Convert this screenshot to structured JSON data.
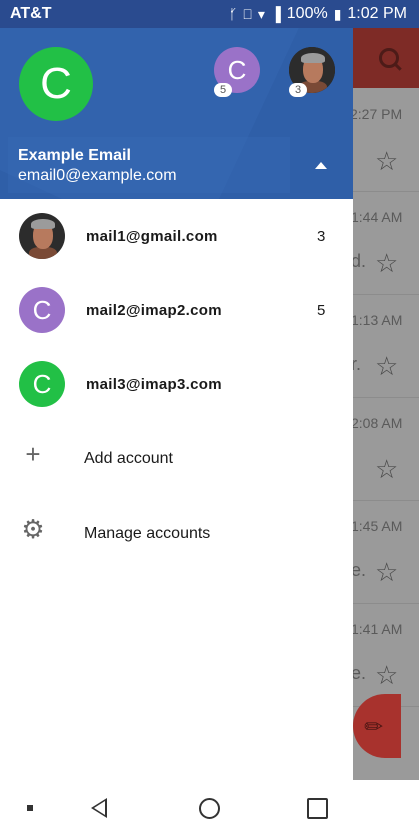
{
  "status_bar": {
    "carrier": "AT&T",
    "battery": "100%",
    "time": "1:02 PM",
    "icons": [
      "bluetooth-icon",
      "nfc-icon",
      "wifi-icon",
      "signal-icon",
      "battery-icon"
    ]
  },
  "drawer": {
    "current_account": {
      "avatar_letter": "C",
      "avatar_color": "#22c046",
      "name": "Example Email",
      "email": "email0@example.com"
    },
    "mini_accounts": [
      {
        "avatar_letter": "C",
        "color": "#9a72c8",
        "badge": "5"
      },
      {
        "avatar_type": "photo",
        "badge": "3"
      }
    ],
    "accounts": [
      {
        "email": "mail1@gmail.com",
        "count": "3",
        "avatar_type": "photo"
      },
      {
        "email": "mail2@imap2.com",
        "count": "5",
        "avatar_letter": "C",
        "color": "#9a72c8"
      },
      {
        "email": "mail3@imap3.com",
        "count": "",
        "avatar_letter": "C",
        "color": "#22c046"
      }
    ],
    "actions": [
      {
        "label": "Add account",
        "icon": "plus-icon"
      },
      {
        "label": "Manage accounts",
        "icon": "gear-icon"
      }
    ]
  },
  "background_list": {
    "times": [
      "2:27 PM",
      "1:44 AM",
      "1:13 AM",
      "2:08 AM",
      "1:45 AM",
      "1:41 AM"
    ]
  },
  "nav_bar": {
    "icons": [
      "recents-dot-icon",
      "back-icon",
      "home-icon",
      "overview-icon"
    ]
  }
}
